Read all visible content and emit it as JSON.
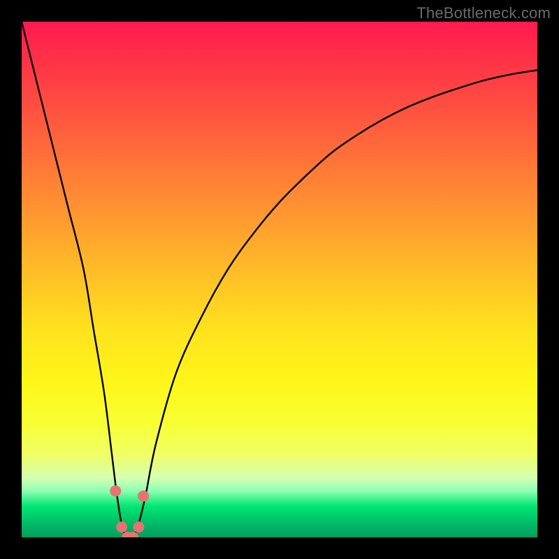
{
  "watermark": "TheBottleneck.com",
  "colors": {
    "frame": "#000000",
    "curve_stroke": "#000000",
    "marker_fill": "#e6736f",
    "marker_stroke": "#c94f4c",
    "gradient_top": "#ff1a50",
    "gradient_bottom": "#009e5e"
  },
  "chart_data": {
    "type": "line",
    "title": "",
    "xlabel": "",
    "ylabel": "",
    "xlim": [
      0,
      100
    ],
    "ylim": [
      0,
      100
    ],
    "series": [
      {
        "name": "bottleneck-curve",
        "x": [
          0,
          3,
          6,
          9,
          12,
          14,
          16,
          17.5,
          18.5,
          19.5,
          20.5,
          21.5,
          22.5,
          24,
          26,
          30,
          35,
          40,
          45,
          50,
          55,
          60,
          65,
          70,
          75,
          80,
          85,
          90,
          95,
          100
        ],
        "values": [
          100,
          88,
          76,
          64,
          52,
          40,
          28,
          16,
          8,
          2,
          0,
          0,
          2,
          8,
          18,
          32,
          43,
          52,
          59,
          65,
          70,
          74.5,
          78,
          81,
          83.5,
          85.5,
          87.2,
          88.7,
          89.8,
          90.6
        ]
      }
    ],
    "markers": {
      "name": "highlight-points",
      "x": [
        18.2,
        19.4,
        20.5,
        21.6,
        22.7,
        23.6
      ],
      "values": [
        9,
        2,
        0,
        0,
        2,
        8
      ]
    }
  }
}
